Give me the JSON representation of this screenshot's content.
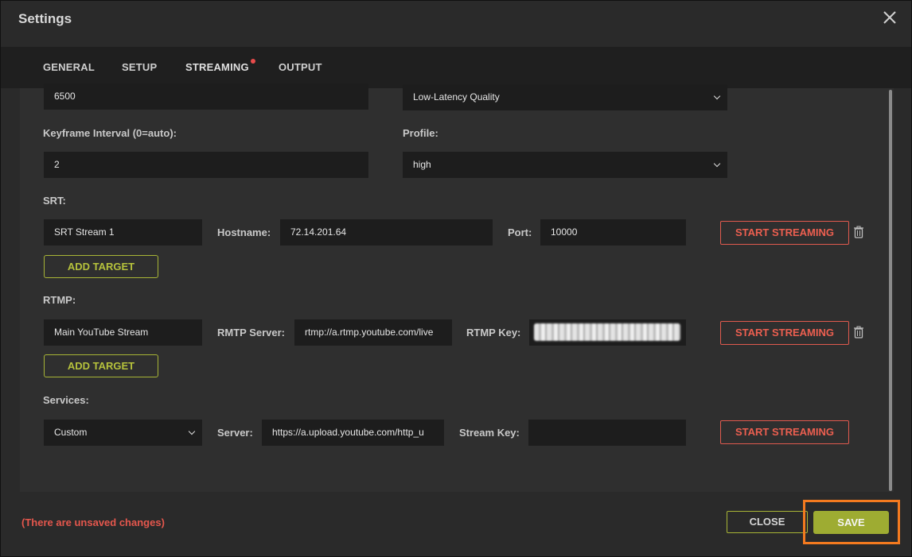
{
  "dialog": {
    "title": "Settings"
  },
  "tabs": [
    {
      "label": "GENERAL"
    },
    {
      "label": "SETUP"
    },
    {
      "label": "STREAMING"
    },
    {
      "label": "OUTPUT"
    }
  ],
  "encoder": {
    "bitrate_value": "6500",
    "preset_value": "Low-Latency Quality",
    "keyframe_label": "Keyframe Interval (0=auto):",
    "keyframe_value": "2",
    "profile_label": "Profile:",
    "profile_value": "high"
  },
  "srt": {
    "section_label": "SRT:",
    "name_value": "SRT Stream 1",
    "hostname_label": "Hostname:",
    "hostname_value": "72.14.201.64",
    "port_label": "Port:",
    "port_value": "10000",
    "start_label": "START STREAMING",
    "add_target_label": "ADD TARGET"
  },
  "rtmp": {
    "section_label": "RTMP:",
    "name_value": "Main YouTube Stream",
    "server_label": "RMTP Server:",
    "server_value": "rtmp://a.rtmp.youtube.com/live",
    "key_label": "RTMP Key:",
    "start_label": "START STREAMING",
    "add_target_label": "ADD TARGET"
  },
  "services": {
    "section_label": "Services:",
    "service_value": "Custom",
    "server_label": "Server:",
    "server_value": "https://a.upload.youtube.com/http_u",
    "stream_key_label": "Stream Key:",
    "stream_key_value": "",
    "start_label": "START STREAMING"
  },
  "footer": {
    "unsaved_message": "(There are unsaved changes)",
    "close_label": "CLOSE",
    "save_label": "SAVE"
  },
  "colors": {
    "accent": "#a8b536",
    "danger": "#ec5f50",
    "highlight": "#f47a1f"
  }
}
